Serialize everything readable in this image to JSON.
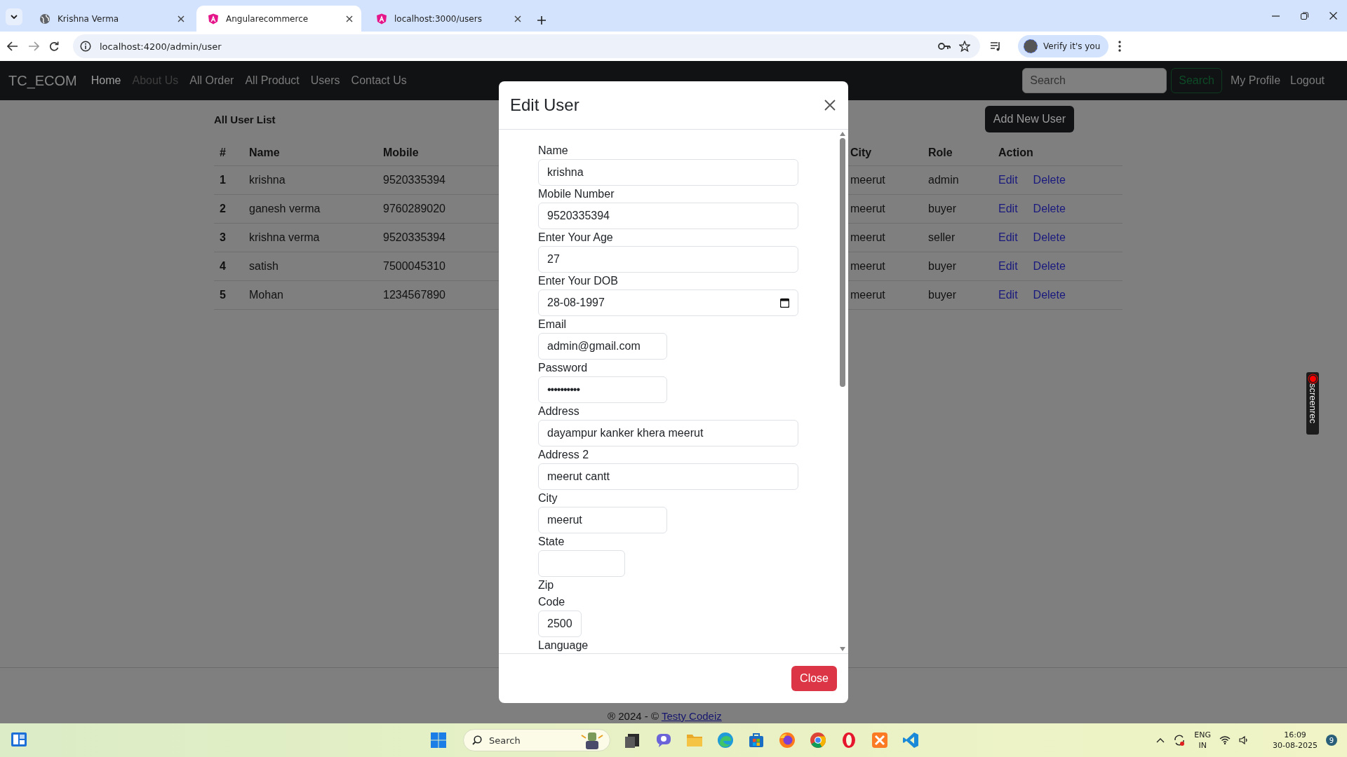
{
  "browser": {
    "tabs": [
      {
        "title": "Krishna Verma",
        "kind": "site",
        "selected": false
      },
      {
        "title": "Angularecommerce",
        "kind": "app",
        "selected": true
      },
      {
        "title": "localhost:3000/users",
        "kind": "app",
        "selected": false
      }
    ],
    "url": "localhost:4200/admin/user",
    "profile_button": "Verify it's you"
  },
  "navbar": {
    "brand": "TC_ECOM",
    "links": [
      {
        "label": "Home",
        "selected": true,
        "disabled": false
      },
      {
        "label": "About Us",
        "selected": false,
        "disabled": true
      },
      {
        "label": "All Order",
        "selected": false,
        "disabled": false
      },
      {
        "label": "All Product",
        "selected": false,
        "disabled": false
      },
      {
        "label": "Users",
        "selected": false,
        "disabled": false
      },
      {
        "label": "Contact Us",
        "selected": false,
        "disabled": false
      }
    ],
    "search": {
      "placeholder": "Search"
    },
    "search_button": "Search",
    "right_links": [
      "My Profile",
      "Logout"
    ]
  },
  "page": {
    "title": "All User List",
    "add_button": "Add New User",
    "table": {
      "columns": [
        "#",
        "Name",
        "Mobile",
        "City",
        "Role",
        "Action"
      ],
      "rows": [
        {
          "cells": [
            "1",
            "krishna",
            "9520335394",
            "meerut",
            "admin"
          ],
          "actions": [
            "Edit",
            "Delete"
          ]
        },
        {
          "cells": [
            "2",
            "ganesh verma",
            "9760289020",
            "meerut",
            "buyer"
          ],
          "actions": [
            "Edit",
            "Delete"
          ]
        },
        {
          "cells": [
            "3",
            "krishna verma",
            "9520335394",
            "meerut",
            "seller"
          ],
          "actions": [
            "Edit",
            "Delete"
          ]
        },
        {
          "cells": [
            "4",
            "satish",
            "7500045310",
            "meerut",
            "buyer"
          ],
          "actions": [
            "Edit",
            "Delete"
          ]
        },
        {
          "cells": [
            "5",
            "Mohan",
            "1234567890",
            "meerut",
            "buyer"
          ],
          "actions": [
            "Edit",
            "Delete"
          ]
        }
      ]
    }
  },
  "modal": {
    "title": "Edit User",
    "fields": [
      {
        "label": "Name",
        "kind": "text",
        "value": "krishna"
      },
      {
        "label": "Mobile Number",
        "kind": "text",
        "value": "9520335394"
      },
      {
        "label": "Enter Your Age",
        "kind": "text",
        "value": "27"
      },
      {
        "label": "Enter Your DOB",
        "kind": "date",
        "value": "28-08-1997"
      },
      {
        "label": "Email",
        "kind": "text",
        "value": "admin@gmail.com"
      },
      {
        "label": "Password",
        "kind": "password",
        "value": "••••••••••"
      },
      {
        "label": "Address",
        "kind": "text",
        "value": "dayampur kanker khera meerut"
      },
      {
        "label": "Address 2",
        "kind": "text",
        "value": "meerut cantt"
      },
      {
        "label": "City",
        "kind": "text",
        "value": "meerut"
      },
      {
        "label": "State",
        "kind": "text"
      },
      {
        "label": "Zip Code",
        "kind": "text",
        "value": "2500"
      },
      {
        "label": "Language",
        "kind": "label"
      }
    ],
    "close_button": "Close"
  },
  "footer": {
    "text": "® 2024 - ©",
    "link": "Testy Codeiz"
  },
  "taskbar": {
    "search": {
      "placeholder": "Search"
    },
    "language": [
      "ENG",
      "IN"
    ],
    "time": "16:09",
    "date": "30-08-2025",
    "notifications": "9"
  },
  "recorder": {
    "label": "screenrec"
  }
}
